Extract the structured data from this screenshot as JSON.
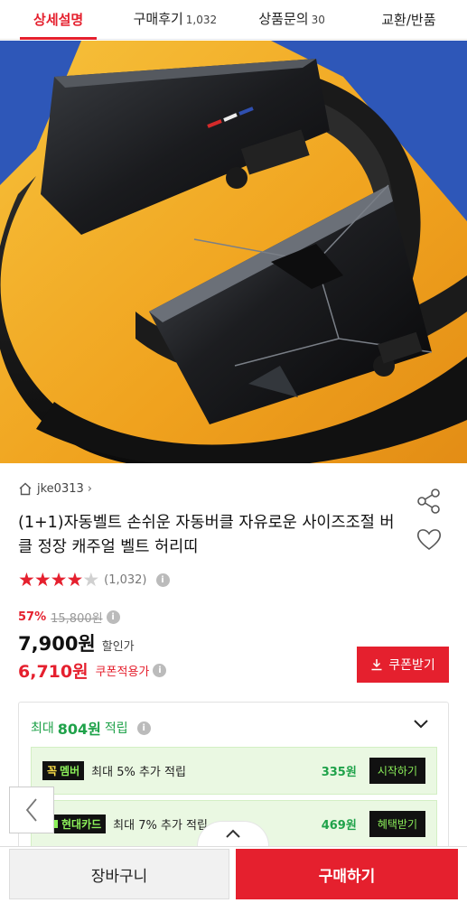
{
  "tabs": [
    {
      "label": "상세설명",
      "count": ""
    },
    {
      "label": "구매후기",
      "count": "1,032"
    },
    {
      "label": "상품문의",
      "count": "30"
    },
    {
      "label": "교환/반품",
      "count": ""
    }
  ],
  "product": {
    "seller": "jke0313",
    "title": "(1+1)자동벨트 손쉬운 자동버클 자유로운 사이즈조절 버클 정장 캐주얼 벨트 허리띠",
    "rating": 4,
    "rating_max": 5,
    "review_count": "(1,032)",
    "discount_pct": "57%",
    "original_price": "15,800원",
    "sale_price": "7,900원",
    "sale_label": "할인가",
    "coupon_price": "6,710원",
    "coupon_label": "쿠폰적용가",
    "coupon_button": "쿠폰받기"
  },
  "points": {
    "prefix": "최대",
    "amount": "804원",
    "suffix": "적립",
    "benefits": [
      {
        "badge_pre": "꼭",
        "badge": "멤버",
        "text": "최대 5% 추가 적립",
        "amount": "335원",
        "button": "시작하기"
      },
      {
        "badge_pre": "",
        "badge": "현대카드",
        "text": "최대 7% 추가 적립",
        "amount": "469원",
        "button": "혜택받기"
      }
    ]
  },
  "bottom": {
    "cart": "장바구니",
    "buy": "구매하기"
  },
  "colors": {
    "accent": "#e5202e",
    "green": "#1fa24a",
    "hero_bg": "#f2ad24"
  }
}
